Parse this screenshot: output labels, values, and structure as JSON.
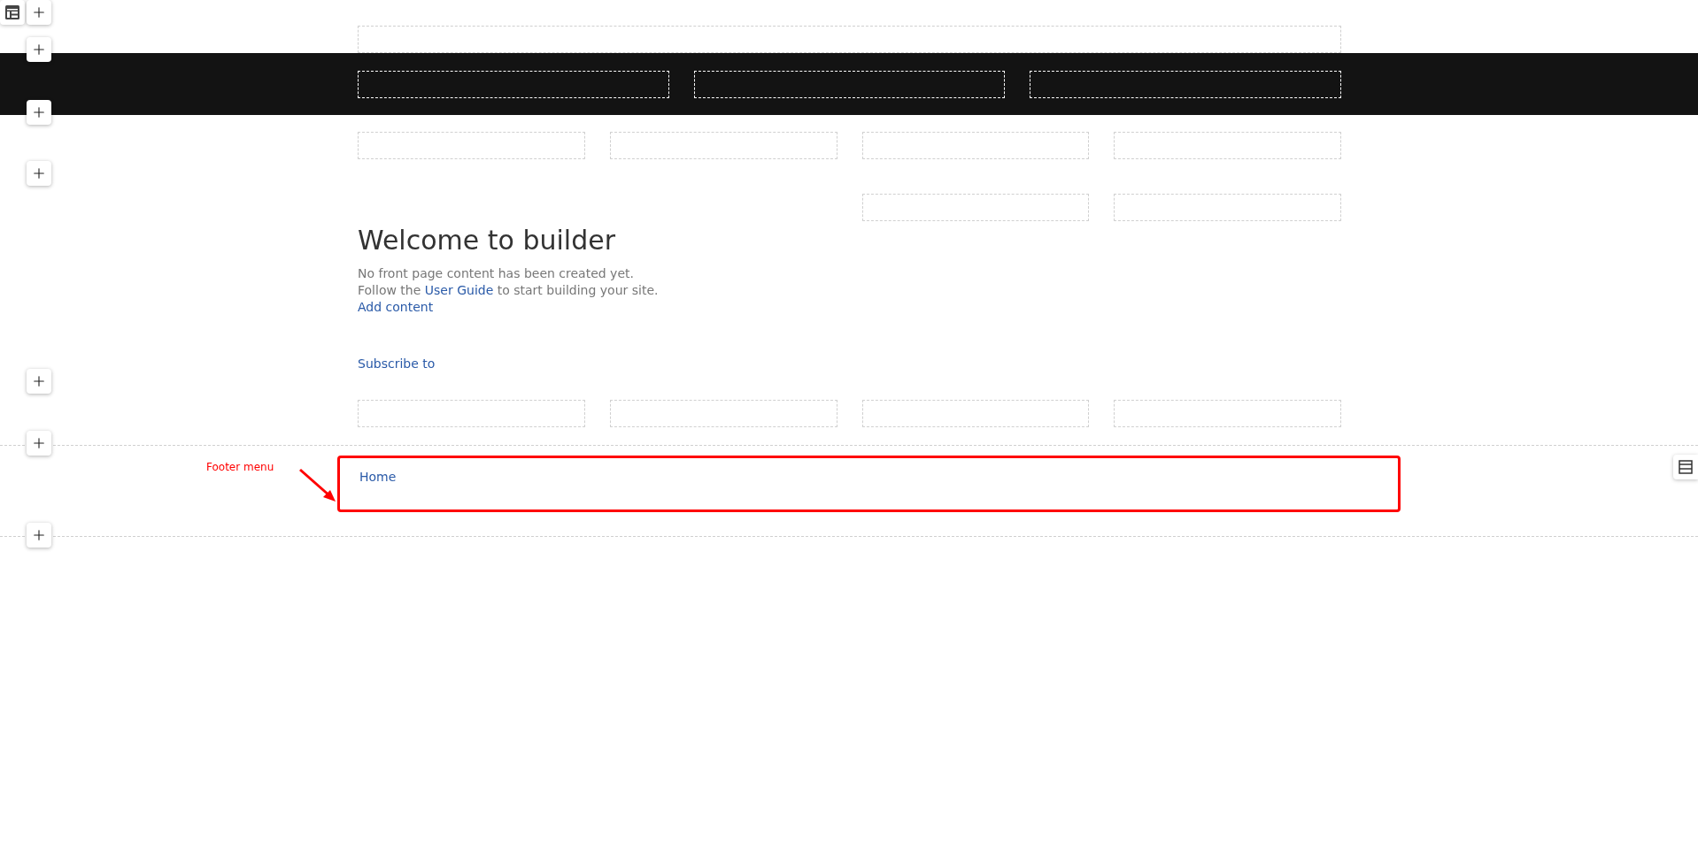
{
  "welcome": {
    "title": "Welcome to builder",
    "line_1": "No front page content has been created yet.",
    "line_2": {
      "before": "Follow the ",
      "link": "User Guide",
      "after": " to start building your site."
    },
    "add_link": "Add content"
  },
  "subscribe": "Subscribe to",
  "footer": {
    "annotation": "Footer menu",
    "menu_items": [
      "Home"
    ]
  }
}
